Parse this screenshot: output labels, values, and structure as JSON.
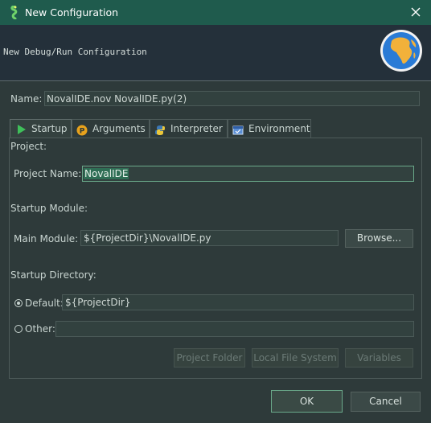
{
  "window": {
    "title": "New Configuration",
    "title_icon": "python-snake-icon",
    "close_icon": "close-icon"
  },
  "header": {
    "heading": "New Debug/Run Configuration",
    "logo_icon": "globe-icon"
  },
  "name": {
    "label": "Name:",
    "value": "NovalIDE.nov NovalIDE.py(2)"
  },
  "tabs": [
    {
      "label": "Startup",
      "icon": "play-icon",
      "active": true
    },
    {
      "label": "Arguments",
      "icon": "arguments-icon",
      "active": false
    },
    {
      "label": "Interpreter",
      "icon": "python-icon",
      "active": false
    },
    {
      "label": "Environment",
      "icon": "environment-icon",
      "active": false
    }
  ],
  "startup": {
    "project_section": "Project:",
    "project_name_label": "Project Name:",
    "project_name_value": "NovalIDE",
    "module_section": "Startup Module:",
    "main_module_label": "Main Module:",
    "main_module_value": "${ProjectDir}\\NovalIDE.py",
    "browse_label": "Browse...",
    "directory_section": "Startup Directory:",
    "default_label": "Default:",
    "default_value": "${ProjectDir}",
    "default_checked": true,
    "other_label": "Other:",
    "other_value": "",
    "other_checked": false,
    "project_folder_label": "Project Folder",
    "local_fs_label": "Local File System",
    "variables_label": "Variables"
  },
  "footer": {
    "ok_label": "OK",
    "cancel_label": "Cancel"
  },
  "colors": {
    "titlebar": "#1f5b4d",
    "background": "#2e3a3a",
    "field": "#32413f",
    "accent": "#6aa98a"
  }
}
